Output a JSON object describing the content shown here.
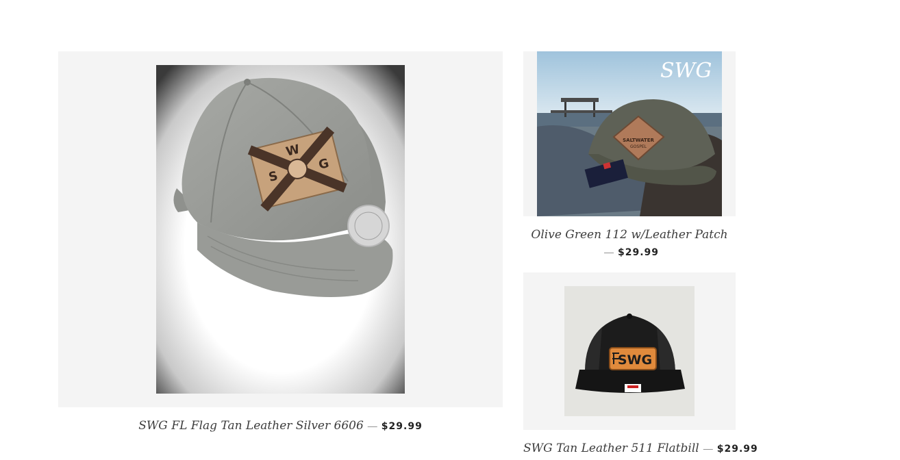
{
  "products": [
    {
      "title": "SWG FL Flag Tan Leather Silver 6606",
      "separator": "—",
      "price": "$29.99",
      "image_icon": "gray-trucker-cap-florida-flag-leather-patch",
      "patch_letters": [
        "S",
        "W",
        "G"
      ],
      "colors": {
        "cap": "#9a9c98",
        "patch": "#c7a27c",
        "stripe": "#4a3428",
        "vignette": "#3a3a3a"
      }
    },
    {
      "title": "Olive Green 112 w/Leather Patch",
      "separator": "—",
      "price": "$29.99",
      "image_icon": "olive-cap-diamond-leather-patch-lake-dock",
      "watermark": "SWG",
      "patch_text": [
        "SALTWATER",
        "GOSPEL"
      ],
      "colors": {
        "sky": "#b9d4e6",
        "water": "#5b6f80",
        "cap": "#5e6156",
        "patch": "#b07a5a"
      }
    },
    {
      "title": "SWG Tan Leather 511 Flatbill",
      "separator": "—",
      "price": "$29.99",
      "image_icon": "black-flatbill-cap-tan-leather-swg-patch",
      "patch_text": "SWG",
      "colors": {
        "bg": "#e4e4e0",
        "cap": "#1c1c1c",
        "patch": "#e08a3c"
      }
    }
  ]
}
